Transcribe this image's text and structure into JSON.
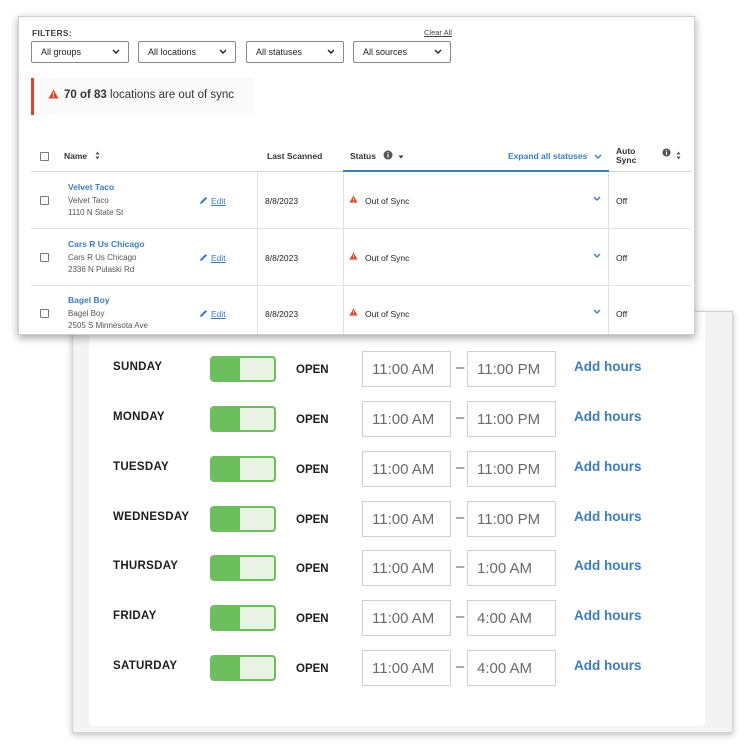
{
  "hours": {
    "days": [
      {
        "name": "SUNDAY",
        "status": "OPEN",
        "open": "11:00 AM",
        "close": "11:00 PM",
        "action": "Add hours"
      },
      {
        "name": "MONDAY",
        "status": "OPEN",
        "open": "11:00 AM",
        "close": "11:00 PM",
        "action": "Add hours"
      },
      {
        "name": "TUESDAY",
        "status": "OPEN",
        "open": "11:00 AM",
        "close": "11:00 PM",
        "action": "Add hours"
      },
      {
        "name": "WEDNESDAY",
        "status": "OPEN",
        "open": "11:00 AM",
        "close": "11:00 PM",
        "action": "Add hours"
      },
      {
        "name": "THURSDAY",
        "status": "OPEN",
        "open": "11:00 AM",
        "close": "1:00 AM",
        "action": "Add hours"
      },
      {
        "name": "FRIDAY",
        "status": "OPEN",
        "open": "11:00 AM",
        "close": "4:00 AM",
        "action": "Add hours"
      },
      {
        "name": "SATURDAY",
        "status": "OPEN",
        "open": "11:00 AM",
        "close": "4:00 AM",
        "action": "Add hours"
      }
    ],
    "separator": "–",
    "toggle_color": "#6cbf5c"
  },
  "filters": {
    "label": "FILTERS:",
    "clear_all": "Clear All",
    "selects": [
      "All groups",
      "All locations",
      "All statuses",
      "All sources"
    ]
  },
  "banner": {
    "count": "70 of 83",
    "message": "locations are out of sync",
    "icon": "warning-triangle-icon",
    "accent_color": "#d8442e"
  },
  "table": {
    "headers": {
      "name": "Name",
      "last_scanned": "Last Scanned",
      "status": "Status",
      "expand": "Expand all statuses",
      "auto_sync_line1": "Auto",
      "auto_sync_line2": "Sync"
    },
    "edit_label": "Edit",
    "rows": [
      {
        "name": "Velvet Taco",
        "sub_name": "Velvet Taco",
        "address": "1110 N State St",
        "last_scanned": "8/8/2023",
        "status": "Out of Sync",
        "auto_sync": "Off"
      },
      {
        "name": "Cars R Us Chicago",
        "sub_name": "Cars R Us Chicago",
        "address": "2336 N Pulaski Rd",
        "last_scanned": "8/8/2023",
        "status": "Out of Sync",
        "auto_sync": "Off"
      },
      {
        "name": "Bagel Boy",
        "sub_name": "Bagel Boy",
        "address": "2505 S Minnesota Ave",
        "last_scanned": "8/8/2023",
        "status": "Out of Sync",
        "auto_sync": "Off"
      }
    ],
    "link_color": "#3c7dbf"
  }
}
